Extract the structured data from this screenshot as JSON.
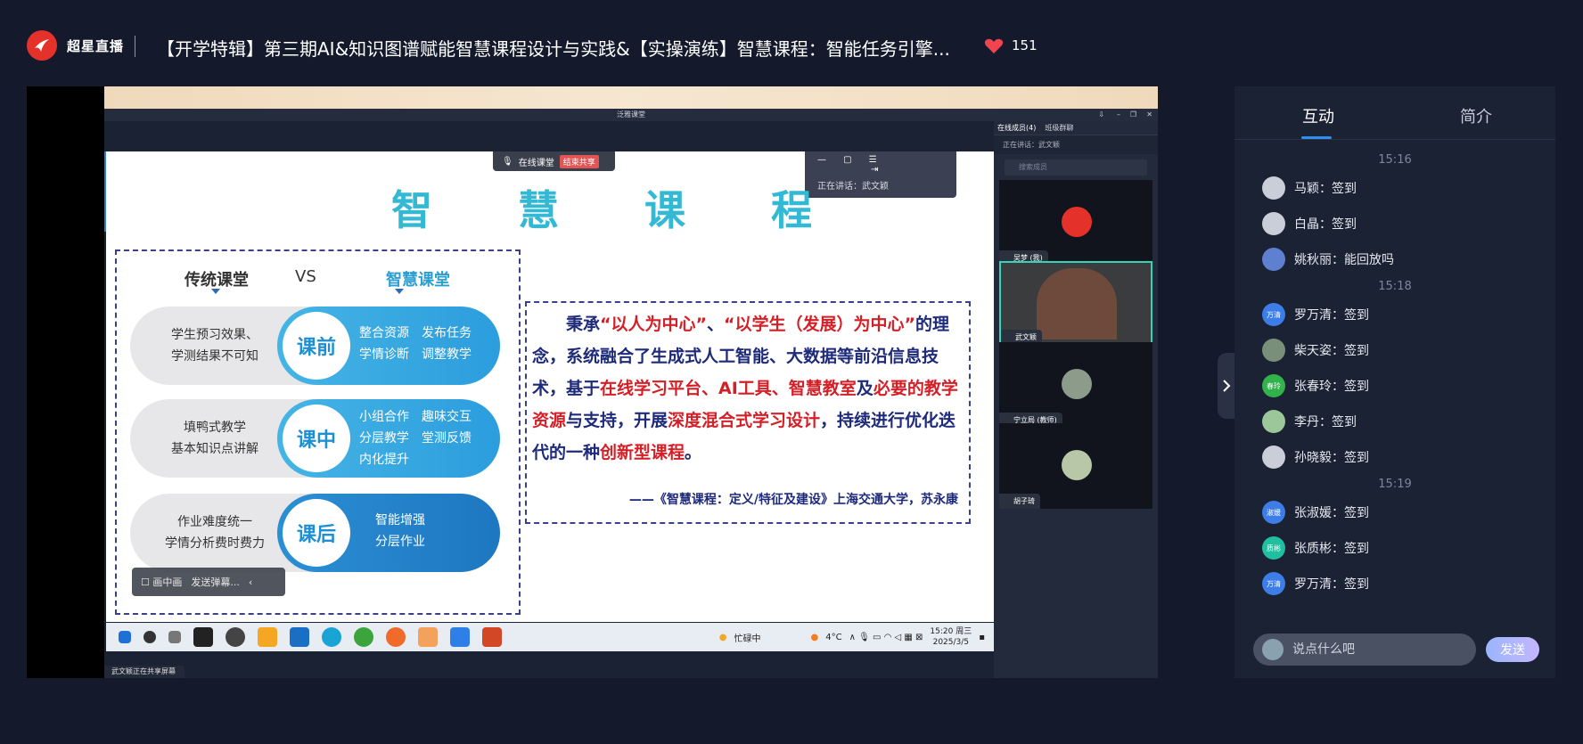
{
  "header": {
    "logo_text": "超星直播",
    "title": "【开学特辑】第三期AI&知识图谱赋能智慧课程设计与实践&【实操演练】智慧课程：智能任务引擎...",
    "likes": "151"
  },
  "shared_window": {
    "title": "泛雅课堂",
    "share_tip": "在线课堂",
    "end_share": "结束共享",
    "speaking_popup": "正在讲话：武文颖",
    "share_status": "武文颖正在共享屏幕"
  },
  "slide": {
    "title": "智 慧 课 程",
    "left_head": "传统课堂",
    "vs": "VS",
    "right_head": "智慧课堂",
    "rows": [
      {
        "left": [
          "学生预习效果、",
          "学测结果不可知"
        ],
        "stage": "课前",
        "items": [
          "整合资源　发布任务",
          "学情诊断　调整教学"
        ]
      },
      {
        "left": [
          "填鸭式教学",
          "基本知识点讲解"
        ],
        "stage": "课中",
        "items": [
          "小组合作　趣味交互",
          "分层教学　堂测反馈",
          "内化提升"
        ]
      },
      {
        "left": [
          "作业难度统一",
          "学情分析费时费力"
        ],
        "stage": "课后",
        "items": [
          "智能增强",
          "分层作业"
        ]
      }
    ],
    "quote_parts": [
      {
        "t": "　　秉承",
        "r": false
      },
      {
        "t": "“以人为中心”",
        "r": true
      },
      {
        "t": "、",
        "r": false
      },
      {
        "t": "“以学生（发展）为中心”",
        "r": true
      },
      {
        "t": "的理念，系统融合了生成式人工智能、大数据等前沿信息技术，基于",
        "r": false
      },
      {
        "t": "在线学习平台、AI工具、智慧教室",
        "r": true
      },
      {
        "t": "及",
        "r": false
      },
      {
        "t": "必要的教学资源",
        "r": true
      },
      {
        "t": "与支持，开展",
        "r": false
      },
      {
        "t": "深度混合式学习设计",
        "r": true
      },
      {
        "t": "，持续进行优化迭代的一种",
        "r": false
      },
      {
        "t": "创新型课程",
        "r": true
      },
      {
        "t": "。",
        "r": false
      }
    ],
    "citation": "——《智慧课程：定义/特征及建设》上海交通大学，苏永康",
    "danmu_draw": "画中画",
    "danmu_send": "发送弹幕..."
  },
  "taskbar": {
    "status": "忙碌中",
    "temp": "4°C",
    "time": "15:20 周三",
    "date": "2025/3/5"
  },
  "members_panel": {
    "tab_online": "在线成员(4)",
    "tab_group": "班级群聊",
    "speaking": "正在讲话：武文颖",
    "search_placeholder": "搜索成员",
    "tiles": [
      {
        "name": "吴梦 (我)"
      },
      {
        "name": "武文颖"
      },
      {
        "name": "宁立局 (教师)"
      },
      {
        "name": "胡子琦"
      }
    ]
  },
  "chat": {
    "tab_interact": "互动",
    "tab_intro": "简介",
    "messages": [
      {
        "type": "time",
        "text": "15:16"
      },
      {
        "type": "msg",
        "text": "马颖：签到",
        "avatar_color": "#c9ced8",
        "avatar_text": ""
      },
      {
        "type": "msg",
        "text": "白晶：签到",
        "avatar_color": "#c9ced8",
        "avatar_text": ""
      },
      {
        "type": "msg",
        "text": "姚秋丽：能回放吗",
        "avatar_color": "#5f7fd0",
        "avatar_text": ""
      },
      {
        "type": "time",
        "text": "15:18"
      },
      {
        "type": "msg",
        "text": "罗万清：签到",
        "avatar_color": "#3c7de8",
        "avatar_text": "万清"
      },
      {
        "type": "msg",
        "text": "柴天姿：签到",
        "avatar_color": "#7a8f7a",
        "avatar_text": ""
      },
      {
        "type": "msg",
        "text": "张春玲：签到",
        "avatar_color": "#32b24a",
        "avatar_text": "春玲"
      },
      {
        "type": "msg",
        "text": "李丹：签到",
        "avatar_color": "#9bc79b",
        "avatar_text": ""
      },
      {
        "type": "msg",
        "text": "孙晓毅：签到",
        "avatar_color": "#c9ced8",
        "avatar_text": ""
      },
      {
        "type": "time",
        "text": "15:19"
      },
      {
        "type": "msg",
        "text": "张淑媛：签到",
        "avatar_color": "#3c7de8",
        "avatar_text": "淑媛"
      },
      {
        "type": "msg",
        "text": "张质彬：签到",
        "avatar_color": "#1fbfa0",
        "avatar_text": "质彬"
      },
      {
        "type": "msg",
        "text": "罗万清：签到",
        "avatar_color": "#3c7de8",
        "avatar_text": "万清"
      }
    ],
    "input_placeholder": "说点什么吧",
    "send_label": "发送"
  },
  "colors": {
    "accent_blue": "#2f8ef0",
    "slide_cyan": "#34b9d4",
    "highlight_red": "#d51f27",
    "brand_red": "#e4322b"
  }
}
